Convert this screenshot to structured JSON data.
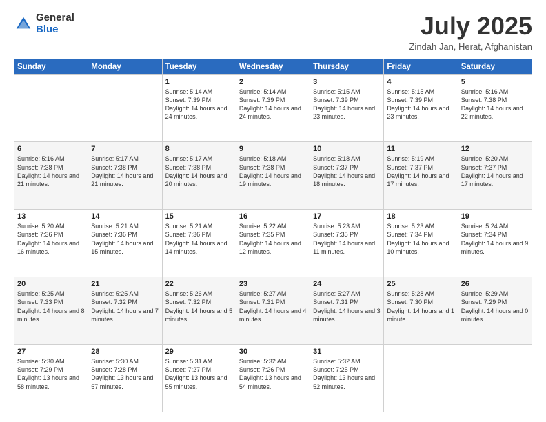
{
  "header": {
    "logo_general": "General",
    "logo_blue": "Blue",
    "month_title": "July 2025",
    "location": "Zindah Jan, Herat, Afghanistan"
  },
  "days_of_week": [
    "Sunday",
    "Monday",
    "Tuesday",
    "Wednesday",
    "Thursday",
    "Friday",
    "Saturday"
  ],
  "weeks": [
    [
      {
        "day": "",
        "sunrise": "",
        "sunset": "",
        "daylight": ""
      },
      {
        "day": "",
        "sunrise": "",
        "sunset": "",
        "daylight": ""
      },
      {
        "day": "1",
        "sunrise": "Sunrise: 5:14 AM",
        "sunset": "Sunset: 7:39 PM",
        "daylight": "Daylight: 14 hours and 24 minutes."
      },
      {
        "day": "2",
        "sunrise": "Sunrise: 5:14 AM",
        "sunset": "Sunset: 7:39 PM",
        "daylight": "Daylight: 14 hours and 24 minutes."
      },
      {
        "day": "3",
        "sunrise": "Sunrise: 5:15 AM",
        "sunset": "Sunset: 7:39 PM",
        "daylight": "Daylight: 14 hours and 23 minutes."
      },
      {
        "day": "4",
        "sunrise": "Sunrise: 5:15 AM",
        "sunset": "Sunset: 7:39 PM",
        "daylight": "Daylight: 14 hours and 23 minutes."
      },
      {
        "day": "5",
        "sunrise": "Sunrise: 5:16 AM",
        "sunset": "Sunset: 7:38 PM",
        "daylight": "Daylight: 14 hours and 22 minutes."
      }
    ],
    [
      {
        "day": "6",
        "sunrise": "Sunrise: 5:16 AM",
        "sunset": "Sunset: 7:38 PM",
        "daylight": "Daylight: 14 hours and 21 minutes."
      },
      {
        "day": "7",
        "sunrise": "Sunrise: 5:17 AM",
        "sunset": "Sunset: 7:38 PM",
        "daylight": "Daylight: 14 hours and 21 minutes."
      },
      {
        "day": "8",
        "sunrise": "Sunrise: 5:17 AM",
        "sunset": "Sunset: 7:38 PM",
        "daylight": "Daylight: 14 hours and 20 minutes."
      },
      {
        "day": "9",
        "sunrise": "Sunrise: 5:18 AM",
        "sunset": "Sunset: 7:38 PM",
        "daylight": "Daylight: 14 hours and 19 minutes."
      },
      {
        "day": "10",
        "sunrise": "Sunrise: 5:18 AM",
        "sunset": "Sunset: 7:37 PM",
        "daylight": "Daylight: 14 hours and 18 minutes."
      },
      {
        "day": "11",
        "sunrise": "Sunrise: 5:19 AM",
        "sunset": "Sunset: 7:37 PM",
        "daylight": "Daylight: 14 hours and 17 minutes."
      },
      {
        "day": "12",
        "sunrise": "Sunrise: 5:20 AM",
        "sunset": "Sunset: 7:37 PM",
        "daylight": "Daylight: 14 hours and 17 minutes."
      }
    ],
    [
      {
        "day": "13",
        "sunrise": "Sunrise: 5:20 AM",
        "sunset": "Sunset: 7:36 PM",
        "daylight": "Daylight: 14 hours and 16 minutes."
      },
      {
        "day": "14",
        "sunrise": "Sunrise: 5:21 AM",
        "sunset": "Sunset: 7:36 PM",
        "daylight": "Daylight: 14 hours and 15 minutes."
      },
      {
        "day": "15",
        "sunrise": "Sunrise: 5:21 AM",
        "sunset": "Sunset: 7:36 PM",
        "daylight": "Daylight: 14 hours and 14 minutes."
      },
      {
        "day": "16",
        "sunrise": "Sunrise: 5:22 AM",
        "sunset": "Sunset: 7:35 PM",
        "daylight": "Daylight: 14 hours and 12 minutes."
      },
      {
        "day": "17",
        "sunrise": "Sunrise: 5:23 AM",
        "sunset": "Sunset: 7:35 PM",
        "daylight": "Daylight: 14 hours and 11 minutes."
      },
      {
        "day": "18",
        "sunrise": "Sunrise: 5:23 AM",
        "sunset": "Sunset: 7:34 PM",
        "daylight": "Daylight: 14 hours and 10 minutes."
      },
      {
        "day": "19",
        "sunrise": "Sunrise: 5:24 AM",
        "sunset": "Sunset: 7:34 PM",
        "daylight": "Daylight: 14 hours and 9 minutes."
      }
    ],
    [
      {
        "day": "20",
        "sunrise": "Sunrise: 5:25 AM",
        "sunset": "Sunset: 7:33 PM",
        "daylight": "Daylight: 14 hours and 8 minutes."
      },
      {
        "day": "21",
        "sunrise": "Sunrise: 5:25 AM",
        "sunset": "Sunset: 7:32 PM",
        "daylight": "Daylight: 14 hours and 7 minutes."
      },
      {
        "day": "22",
        "sunrise": "Sunrise: 5:26 AM",
        "sunset": "Sunset: 7:32 PM",
        "daylight": "Daylight: 14 hours and 5 minutes."
      },
      {
        "day": "23",
        "sunrise": "Sunrise: 5:27 AM",
        "sunset": "Sunset: 7:31 PM",
        "daylight": "Daylight: 14 hours and 4 minutes."
      },
      {
        "day": "24",
        "sunrise": "Sunrise: 5:27 AM",
        "sunset": "Sunset: 7:31 PM",
        "daylight": "Daylight: 14 hours and 3 minutes."
      },
      {
        "day": "25",
        "sunrise": "Sunrise: 5:28 AM",
        "sunset": "Sunset: 7:30 PM",
        "daylight": "Daylight: 14 hours and 1 minute."
      },
      {
        "day": "26",
        "sunrise": "Sunrise: 5:29 AM",
        "sunset": "Sunset: 7:29 PM",
        "daylight": "Daylight: 14 hours and 0 minutes."
      }
    ],
    [
      {
        "day": "27",
        "sunrise": "Sunrise: 5:30 AM",
        "sunset": "Sunset: 7:29 PM",
        "daylight": "Daylight: 13 hours and 58 minutes."
      },
      {
        "day": "28",
        "sunrise": "Sunrise: 5:30 AM",
        "sunset": "Sunset: 7:28 PM",
        "daylight": "Daylight: 13 hours and 57 minutes."
      },
      {
        "day": "29",
        "sunrise": "Sunrise: 5:31 AM",
        "sunset": "Sunset: 7:27 PM",
        "daylight": "Daylight: 13 hours and 55 minutes."
      },
      {
        "day": "30",
        "sunrise": "Sunrise: 5:32 AM",
        "sunset": "Sunset: 7:26 PM",
        "daylight": "Daylight: 13 hours and 54 minutes."
      },
      {
        "day": "31",
        "sunrise": "Sunrise: 5:32 AM",
        "sunset": "Sunset: 7:25 PM",
        "daylight": "Daylight: 13 hours and 52 minutes."
      },
      {
        "day": "",
        "sunrise": "",
        "sunset": "",
        "daylight": ""
      },
      {
        "day": "",
        "sunrise": "",
        "sunset": "",
        "daylight": ""
      }
    ]
  ]
}
